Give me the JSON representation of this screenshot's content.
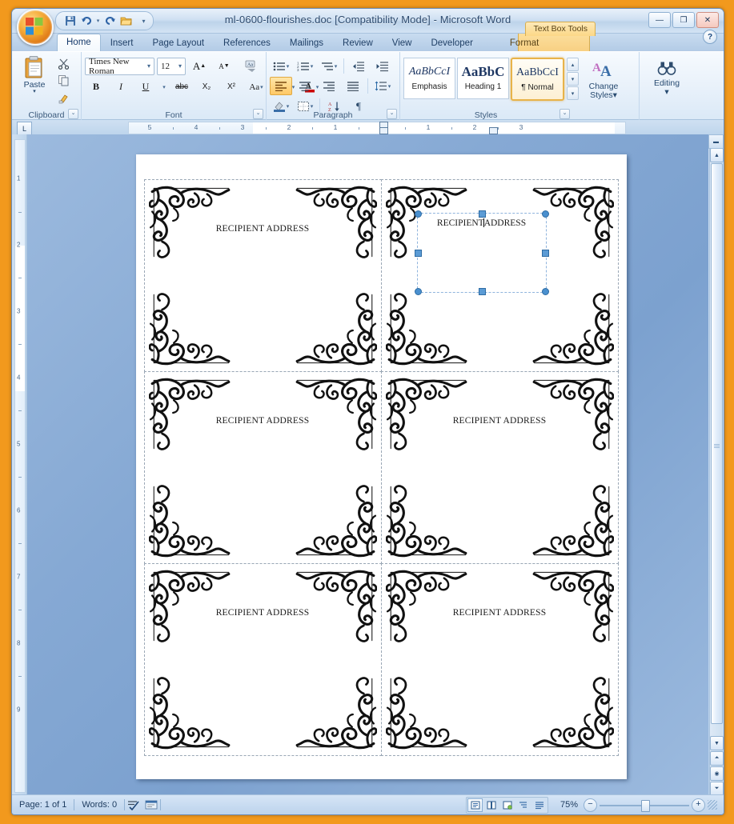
{
  "window": {
    "title": "ml-0600-flourishes.doc [Compatibility Mode] - Microsoft Word",
    "contextual_tab_label": "Text Box Tools",
    "minimize_label": "—",
    "restore_label": "❐",
    "close_label": "✕",
    "help_label": "?"
  },
  "quick_access": {
    "office_button": "Office Button",
    "items": [
      {
        "name": "save-icon",
        "glyph": "Ὃe"
      },
      {
        "name": "undo-icon",
        "glyph": "↶"
      },
      {
        "name": "undo-dropdown-icon",
        "glyph": "▾"
      },
      {
        "name": "redo-icon",
        "glyph": "↷"
      },
      {
        "name": "open-icon",
        "glyph": "📂"
      },
      {
        "name": "customize-qat-icon",
        "glyph": "▾"
      }
    ]
  },
  "tabs": [
    {
      "label": "Home",
      "active": true,
      "contextual": false
    },
    {
      "label": "Insert",
      "active": false,
      "contextual": false
    },
    {
      "label": "Page Layout",
      "active": false,
      "contextual": false
    },
    {
      "label": "References",
      "active": false,
      "contextual": false
    },
    {
      "label": "Mailings",
      "active": false,
      "contextual": false
    },
    {
      "label": "Review",
      "active": false,
      "contextual": false
    },
    {
      "label": "View",
      "active": false,
      "contextual": false
    },
    {
      "label": "Developer",
      "active": false,
      "contextual": false
    },
    {
      "label": "Format",
      "active": false,
      "contextual": true
    }
  ],
  "ribbon": {
    "clipboard": {
      "label": "Clipboard",
      "paste_label": "Paste",
      "paste_arrow": "▾",
      "cut_icon": "✂",
      "copy_icon": "⧉",
      "format_painter_icon": "🖌",
      "dialog_launcher": "⌄"
    },
    "font": {
      "label": "Font",
      "font_name": "Times New Roman",
      "font_size": "12",
      "caret": "▾",
      "grow_font": "A",
      "shrink_font": "A",
      "clear_formatting": "Aa",
      "bold": "B",
      "italic": "I",
      "underline": "U",
      "strikethrough": "abc",
      "subscript": "X₂",
      "superscript": "X²",
      "change_case": "Aa",
      "highlight": "ab",
      "font_color": "A",
      "dialog_launcher": "⌄"
    },
    "paragraph": {
      "label": "Paragraph",
      "bullets": "≔",
      "numbering": "≕",
      "multilevel": "≖",
      "decrease_indent": "⇤",
      "increase_indent": "⇥",
      "align_left": "≡",
      "align_center": "≡",
      "align_right": "≡",
      "justify": "≡",
      "line_spacing": "↕",
      "shading": "▨",
      "borders": "⊞",
      "sort": "A↓",
      "show_marks": "¶",
      "dialog_launcher": "⌄"
    },
    "styles": {
      "label": "Styles",
      "items": [
        {
          "preview": "AaBbCcI",
          "name": "Emphasis",
          "selected": false
        },
        {
          "preview": "AaBbC",
          "name": "Heading 1",
          "selected": false
        },
        {
          "preview": "AaBbCcI",
          "name": "¶ Normal",
          "selected": true
        }
      ],
      "scroll_up": "▴",
      "scroll_down": "▾",
      "more": "▾",
      "change_styles_label": "Change\nStyles",
      "change_styles_line1": "Change",
      "change_styles_line2": "Styles",
      "change_styles_arrow": "▾",
      "dialog_launcher": "⌄"
    },
    "editing": {
      "label": "Editing",
      "icon": "🔍",
      "arrow": "▾"
    }
  },
  "rulers": {
    "tab_selector": "L",
    "horizontal_left_numbers": [
      "5",
      "4",
      "3",
      "2",
      "1"
    ],
    "horizontal_right_numbers": [
      "1",
      "2",
      "3"
    ],
    "vertical_numbers": [
      "1",
      "2",
      "3",
      "4",
      "5",
      "6",
      "7",
      "8",
      "9"
    ]
  },
  "document": {
    "label_text": "RECIPIENT ADDRESS",
    "selected_cell_index": 1,
    "cells": [
      {
        "text": "RECIPIENT ADDRESS",
        "selected": false
      },
      {
        "text": "RECIPIENT ADDRESS",
        "selected": true
      },
      {
        "text": "RECIPIENT ADDRESS",
        "selected": false
      },
      {
        "text": "RECIPIENT ADDRESS",
        "selected": false
      },
      {
        "text": "RECIPIENT ADDRESS",
        "selected": false
      },
      {
        "text": "RECIPIENT ADDRESS",
        "selected": false
      }
    ],
    "selected_text_before_caret": "RECIPIENT",
    "selected_text_after_caret": "ADDRESS"
  },
  "scrollbar": {
    "up_arrow": "▲",
    "down_arrow": "▼",
    "split": "▬",
    "previous_object": "⏶",
    "select_object": "◉",
    "next_object": "⏷"
  },
  "status_bar": {
    "page": "Page: 1 of 1",
    "words": "Words: 0",
    "proofing_icon": "✓",
    "language_icon": "▤",
    "zoom_level": "75%",
    "zoom_out": "−",
    "zoom_in": "+",
    "views": [
      {
        "name": "print-layout",
        "glyph": "▤",
        "active": true
      },
      {
        "name": "full-screen-reading",
        "glyph": "▥",
        "active": false
      },
      {
        "name": "web-layout",
        "glyph": "▦",
        "active": false
      },
      {
        "name": "outline",
        "glyph": "▤",
        "active": false
      },
      {
        "name": "draft",
        "glyph": "▤",
        "active": false
      }
    ]
  },
  "colors": {
    "desktop": "#f2991d",
    "accent_gold": "#ffc866",
    "selection_blue": "#5b9bd5",
    "page_white": "#ffffff"
  }
}
